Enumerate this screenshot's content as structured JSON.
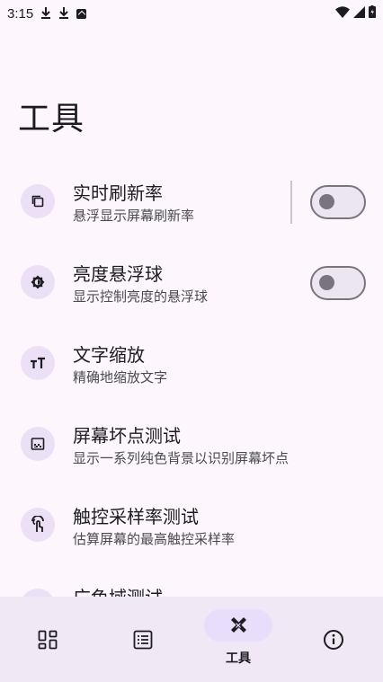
{
  "status_bar": {
    "time": "3:15",
    "notification_icons": [
      "download-icon",
      "download-icon",
      "app-notification-icon"
    ],
    "system_icons": [
      "wifi-icon",
      "signal-icon",
      "battery-icon"
    ]
  },
  "page": {
    "title": "工具"
  },
  "items": [
    {
      "title": "实时刷新率",
      "subtitle": "悬浮显示屏幕刷新率",
      "icon": "layers-icon",
      "toggle": false
    },
    {
      "title": "亮度悬浮球",
      "subtitle": "显示控制亮度的悬浮球",
      "icon": "brightness-icon",
      "toggle": false
    },
    {
      "title": "文字缩放",
      "subtitle": "精确地缩放文字",
      "icon": "text-size-icon"
    },
    {
      "title": "屏幕坏点测试",
      "subtitle": "显示一系列纯色背景以识别屏幕坏点",
      "icon": "pixel-test-icon"
    },
    {
      "title": "触控采样率测试",
      "subtitle": "估算屏幕的最高触控采样率",
      "icon": "touch-icon"
    },
    {
      "title": "广色域测试",
      "icon": "color-gamut-icon"
    }
  ],
  "nav": {
    "items": [
      {
        "icon": "dashboard-icon"
      },
      {
        "icon": "list-icon"
      },
      {
        "icon": "tools-icon",
        "label": "工具",
        "active": true
      },
      {
        "icon": "info-icon"
      }
    ]
  },
  "colors": {
    "background": "#fdf7fd",
    "accent_container": "#e8ddfb",
    "icon_bg": "#ece0f7",
    "nav_bg": "#f0e8f5"
  }
}
